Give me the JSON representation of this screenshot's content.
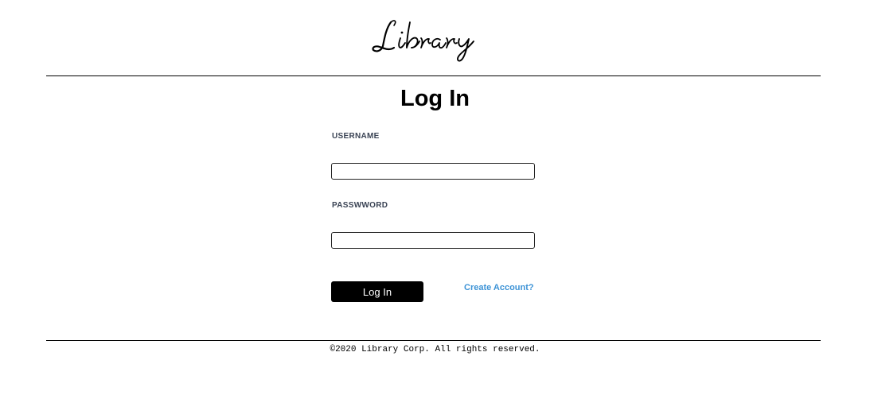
{
  "header": {
    "logo_text": "Library"
  },
  "login_form": {
    "title": "Log In",
    "username_label": "USERNAME",
    "username_value": "",
    "password_label": "PASSWWORD",
    "password_value": "",
    "submit_label": "Log In",
    "create_account_label": "Create Account?"
  },
  "footer": {
    "copyright": "©2020 Library Corp. All rights reserved."
  },
  "colors": {
    "link": "#3d93d6",
    "label": "#3a4354",
    "button_bg": "#000000",
    "button_text": "#ffffff"
  }
}
